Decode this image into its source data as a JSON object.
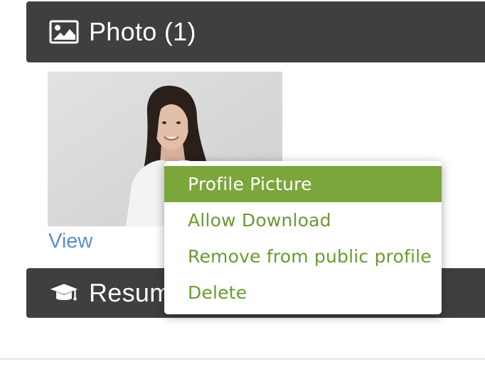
{
  "photo_section": {
    "title": "Photo (1)",
    "icon": "image-icon",
    "view_link": "View"
  },
  "resume_section": {
    "title": "Resume",
    "icon": "graduation-cap-icon"
  },
  "context_menu": {
    "items": [
      {
        "label": "Profile Picture",
        "active": true
      },
      {
        "label": "Allow Download",
        "active": false
      },
      {
        "label": "Remove from public profile",
        "active": false
      },
      {
        "label": "Delete",
        "active": false
      }
    ]
  },
  "colors": {
    "header_bg": "#3f3f3f",
    "menu_accent": "#7ba63b",
    "menu_text": "#6a9a33",
    "link": "#5b8ec9"
  }
}
